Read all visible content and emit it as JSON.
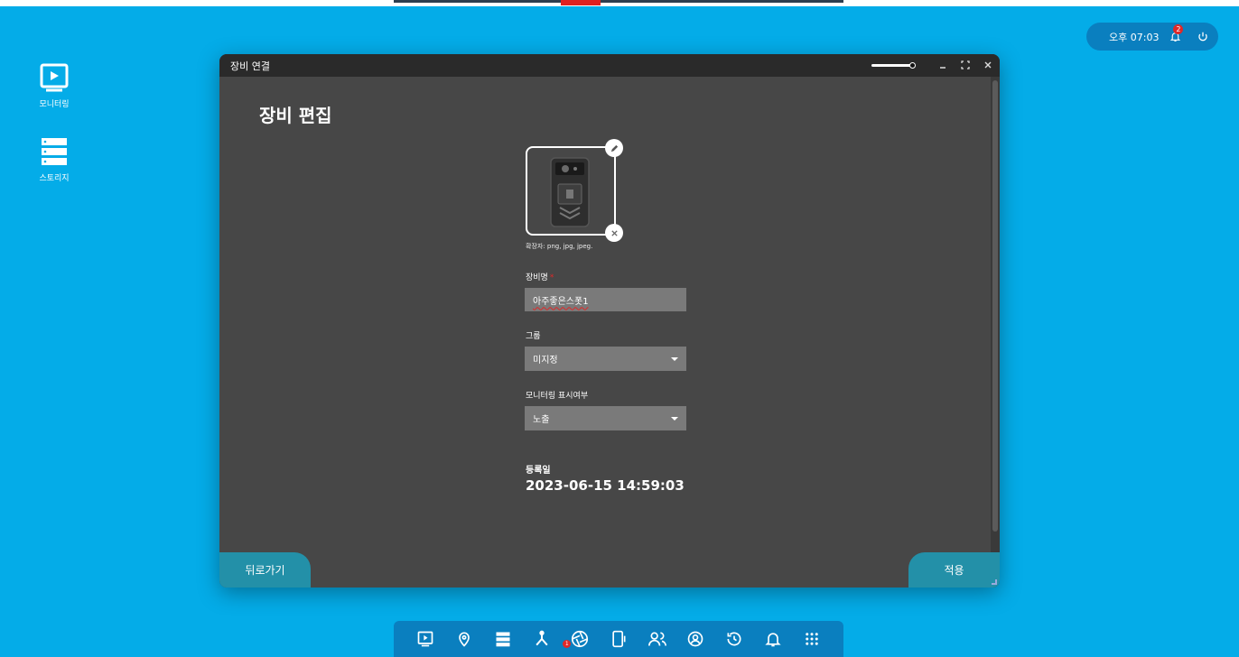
{
  "status": {
    "time": "오후 07:03",
    "notification_count": "2"
  },
  "desktop": {
    "icons": [
      {
        "label": "모니터링",
        "icon": "monitor-play-icon"
      },
      {
        "label": "스토리지",
        "icon": "storage-icon"
      }
    ]
  },
  "window": {
    "title": "장비 연결",
    "page_title": "장비 편집",
    "image_hint": "확장자: png, jpg, jpeg.",
    "fields": {
      "name_label": "장비명",
      "name_value": "아주좋은스폿1",
      "group_label": "그룹",
      "group_value": "미지정",
      "monitor_label": "모니터링 표시여부",
      "monitor_value": "노출"
    },
    "registered": {
      "label": "등록일",
      "value": "2023-06-15 14:59:03"
    },
    "buttons": {
      "back": "뒤로가기",
      "apply": "적용"
    }
  },
  "taskbar": {
    "icons": [
      "monitor-play-icon",
      "location-pin-icon",
      "storage-icon",
      "network-icon",
      "camera-aperture-icon",
      "device-icon",
      "users-icon",
      "user-circle-icon",
      "history-icon",
      "bell-icon",
      "apps-grid-icon"
    ],
    "badge": "1"
  },
  "colors": {
    "desktop_bg": "#04ace8",
    "window_bg": "#474747",
    "accent_button": "#2390a8",
    "taskbar_bg": "#0a7fbf",
    "badge_red": "#e02828"
  }
}
